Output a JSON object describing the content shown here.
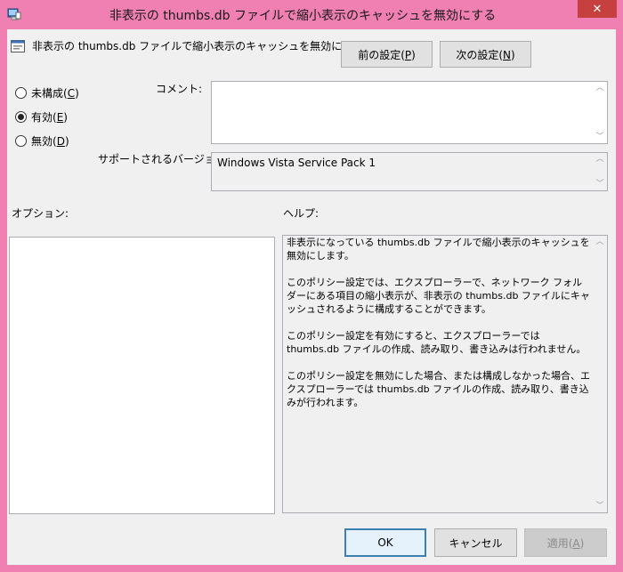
{
  "window": {
    "title": "非表示の thumbs.db ファイルで縮小表示のキャッシュを無効にする",
    "close_label": "✕",
    "accent": "#f07fb2"
  },
  "policy": {
    "name": "非表示の thumbs.db ファイルで縮小表示のキャッシュを無効にする",
    "prev_button": {
      "text": "前の設定(",
      "key": "P",
      "close": ")"
    },
    "next_button": {
      "text": "次の設定(",
      "key": "N",
      "close": ")"
    }
  },
  "state": {
    "options": [
      {
        "text": "未構成(",
        "key": "C",
        "close": ")",
        "checked": false
      },
      {
        "text": "有効(",
        "key": "E",
        "close": ")",
        "checked": true
      },
      {
        "text": "無効(",
        "key": "D",
        "close": ")",
        "checked": false
      }
    ]
  },
  "comment": {
    "label": "コメント:",
    "value": ""
  },
  "supported": {
    "label": "サポートされるバージョン:",
    "value": "Windows Vista Service Pack 1"
  },
  "options_section": {
    "label": "オプション:"
  },
  "help_section": {
    "label": "ヘルプ:",
    "paragraphs": [
      "非表示になっている thumbs.db ファイルで縮小表示のキャッシュを無効にします。",
      "このポリシー設定では、エクスプローラーで、ネットワーク フォルダーにある項目の縮小表示が、非表示の thumbs.db ファイルにキャッシュされるように構成することができます。",
      "このポリシー設定を有効にすると、エクスプローラーでは thumbs.db ファイルの作成、読み取り、書き込みは行われません。",
      "このポリシー設定を無効にした場合、または構成しなかった場合、エクスプローラーでは thumbs.db ファイルの作成、読み取り、書き込みが行われます。"
    ]
  },
  "footer": {
    "ok": "OK",
    "cancel": "キャンセル",
    "apply": {
      "text": "適用(",
      "key": "A",
      "close": ")"
    }
  }
}
